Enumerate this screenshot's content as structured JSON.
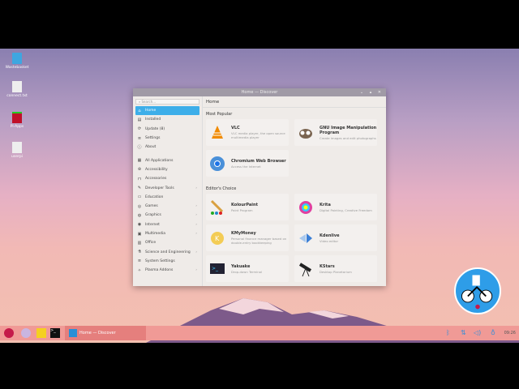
{
  "desktop": {
    "icons": [
      {
        "label": "Wastebasket"
      },
      {
        "label": "connect.txt"
      },
      {
        "label": "Pi-Apps"
      },
      {
        "label": "userpi"
      }
    ]
  },
  "window": {
    "title": "Home — Discover",
    "controls": "⌄ ▴ ✕"
  },
  "sidebar": {
    "search_placeholder": "Search...",
    "items": [
      {
        "label": "Home",
        "icon": "home-icon",
        "glyph": "⌂"
      },
      {
        "label": "Installed",
        "icon": "installed-icon",
        "glyph": "▤"
      },
      {
        "label": "Update (8)",
        "icon": "update-icon",
        "glyph": "⟳"
      },
      {
        "label": "Settings",
        "icon": "settings-icon",
        "glyph": "≡"
      },
      {
        "label": "About",
        "icon": "info-icon",
        "glyph": "ⓘ"
      },
      {
        "label": "All Applications",
        "icon": "grid-icon",
        "glyph": "▦"
      },
      {
        "label": "Accessibility",
        "icon": "accessibility-icon",
        "glyph": "⊛"
      },
      {
        "label": "Accessories",
        "icon": "accessories-icon",
        "glyph": "⊓"
      },
      {
        "label": "Developer Tools",
        "icon": "tools-icon",
        "glyph": "✎",
        "chev": "›"
      },
      {
        "label": "Education",
        "icon": "education-icon",
        "glyph": "▭"
      },
      {
        "label": "Games",
        "icon": "games-icon",
        "glyph": "◎",
        "chev": "›"
      },
      {
        "label": "Graphics",
        "icon": "graphics-icon",
        "glyph": "◍",
        "chev": "›"
      },
      {
        "label": "Internet",
        "icon": "internet-icon",
        "glyph": "◉",
        "chev": "›"
      },
      {
        "label": "Multimedia",
        "icon": "multimedia-icon",
        "glyph": "▣",
        "chev": "›"
      },
      {
        "label": "Office",
        "icon": "office-icon",
        "glyph": "▥"
      },
      {
        "label": "Science and Engineering",
        "icon": "science-icon",
        "glyph": "⚗",
        "chev": "›"
      },
      {
        "label": "System Settings",
        "icon": "system-settings-icon",
        "glyph": "≡"
      },
      {
        "label": "Plasma Addons",
        "icon": "plasma-icon",
        "glyph": "✧",
        "chev": "›"
      }
    ]
  },
  "main": {
    "header": "Home",
    "most_popular": "Most Popular",
    "editors_choice": "Editor's Choice",
    "popular": [
      {
        "name": "VLC",
        "desc": "VLC media player, the open source multimedia player"
      },
      {
        "name": "GNU Image Manipulation Program",
        "desc": "Create images and edit photographs"
      },
      {
        "name": "Chromium Web Browser",
        "desc": "Access the Internet"
      }
    ],
    "editors": [
      {
        "name": "KolourPaint",
        "desc": "Paint Program"
      },
      {
        "name": "Krita",
        "desc": "Digital Painting, Creative Freedom"
      },
      {
        "name": "KMyMoney",
        "desc": "Personal finance manager based on double-entry bookkeeping"
      },
      {
        "name": "Kdenlive",
        "desc": "Video editor"
      },
      {
        "name": "Yakuake",
        "desc": "Drop-down Terminal"
      },
      {
        "name": "KStars",
        "desc": "Desktop Planetarium"
      }
    ]
  },
  "taskbar": {
    "window_label": "Home — Discover",
    "clock": "09:26",
    "accent": "#3daee9"
  }
}
